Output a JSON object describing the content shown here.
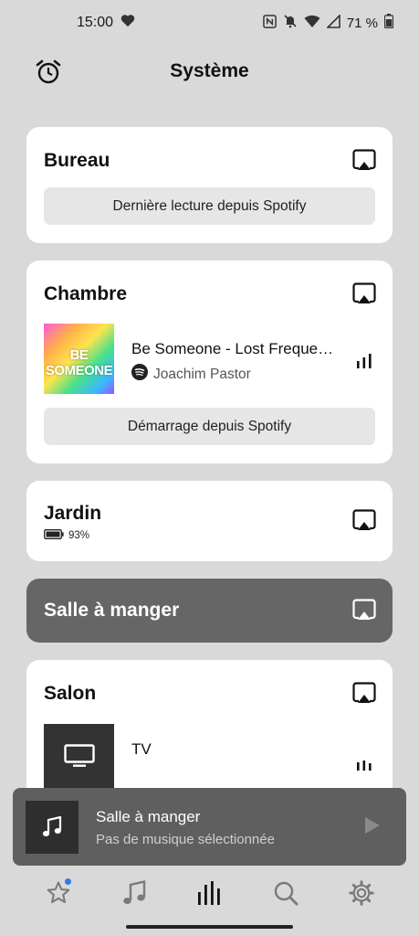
{
  "status_bar": {
    "time": "15:00",
    "battery": "71 %"
  },
  "header": {
    "title": "Système"
  },
  "rooms": [
    {
      "name": "Bureau",
      "action": "Dernière lecture depuis Spotify"
    },
    {
      "name": "Chambre",
      "action": "Démarrage depuis Spotify",
      "track": {
        "title": "Be Someone - Lost Frequencies",
        "artist": "Joachim Pastor",
        "album_art_text": "BE SOMEONE"
      }
    },
    {
      "name": "Jardin",
      "battery": "93%"
    },
    {
      "name": "Salle à manger"
    },
    {
      "name": "Salon",
      "source": "TV"
    }
  ],
  "now_playing": {
    "room": "Salle à manger",
    "status": "Pas de musique sélectionnée"
  },
  "nav": {
    "items": [
      "favorites",
      "music",
      "system",
      "search",
      "settings"
    ],
    "active": "system"
  }
}
